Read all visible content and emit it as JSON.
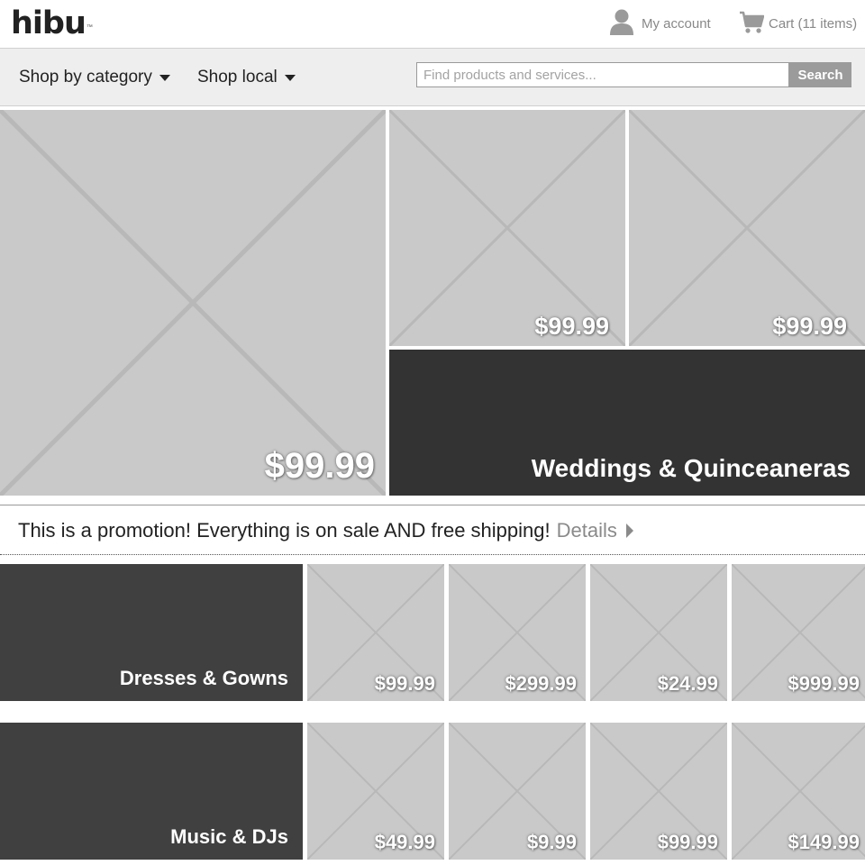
{
  "header": {
    "logo_text": "hibu",
    "logo_tm": "™",
    "account_icon": "user-icon",
    "account_label": "My account",
    "cart_icon": "cart-icon",
    "cart_label": "Cart (11 items)"
  },
  "nav": {
    "shop_by_category": "Shop by category",
    "shop_local": "Shop local",
    "search_placeholder": "Find products and services...",
    "search_value": "",
    "search_button": "Search"
  },
  "hero": {
    "large_price": "$99.99",
    "small_price_1": "$99.99",
    "small_price_2": "$99.99",
    "feature_label": "Weddings & Quinceaneras"
  },
  "promo": {
    "text": "This is a promotion! Everything is on sale AND free shipping!",
    "link": "Details"
  },
  "rows": [
    {
      "category": "Dresses & Gowns",
      "prices": [
        "$99.99",
        "$299.99",
        "$24.99",
        "$999.99"
      ]
    },
    {
      "category": "Music & DJs",
      "prices": [
        "$49.99",
        "$9.99",
        "$99.99",
        "$149.99"
      ]
    }
  ],
  "colors": {
    "placeholder": "#c9c9c9",
    "placeholder_x": "#b8b8b8",
    "dark_tile": "#333333",
    "category_tile": "#404040",
    "search_button": "#9b9b9b"
  }
}
